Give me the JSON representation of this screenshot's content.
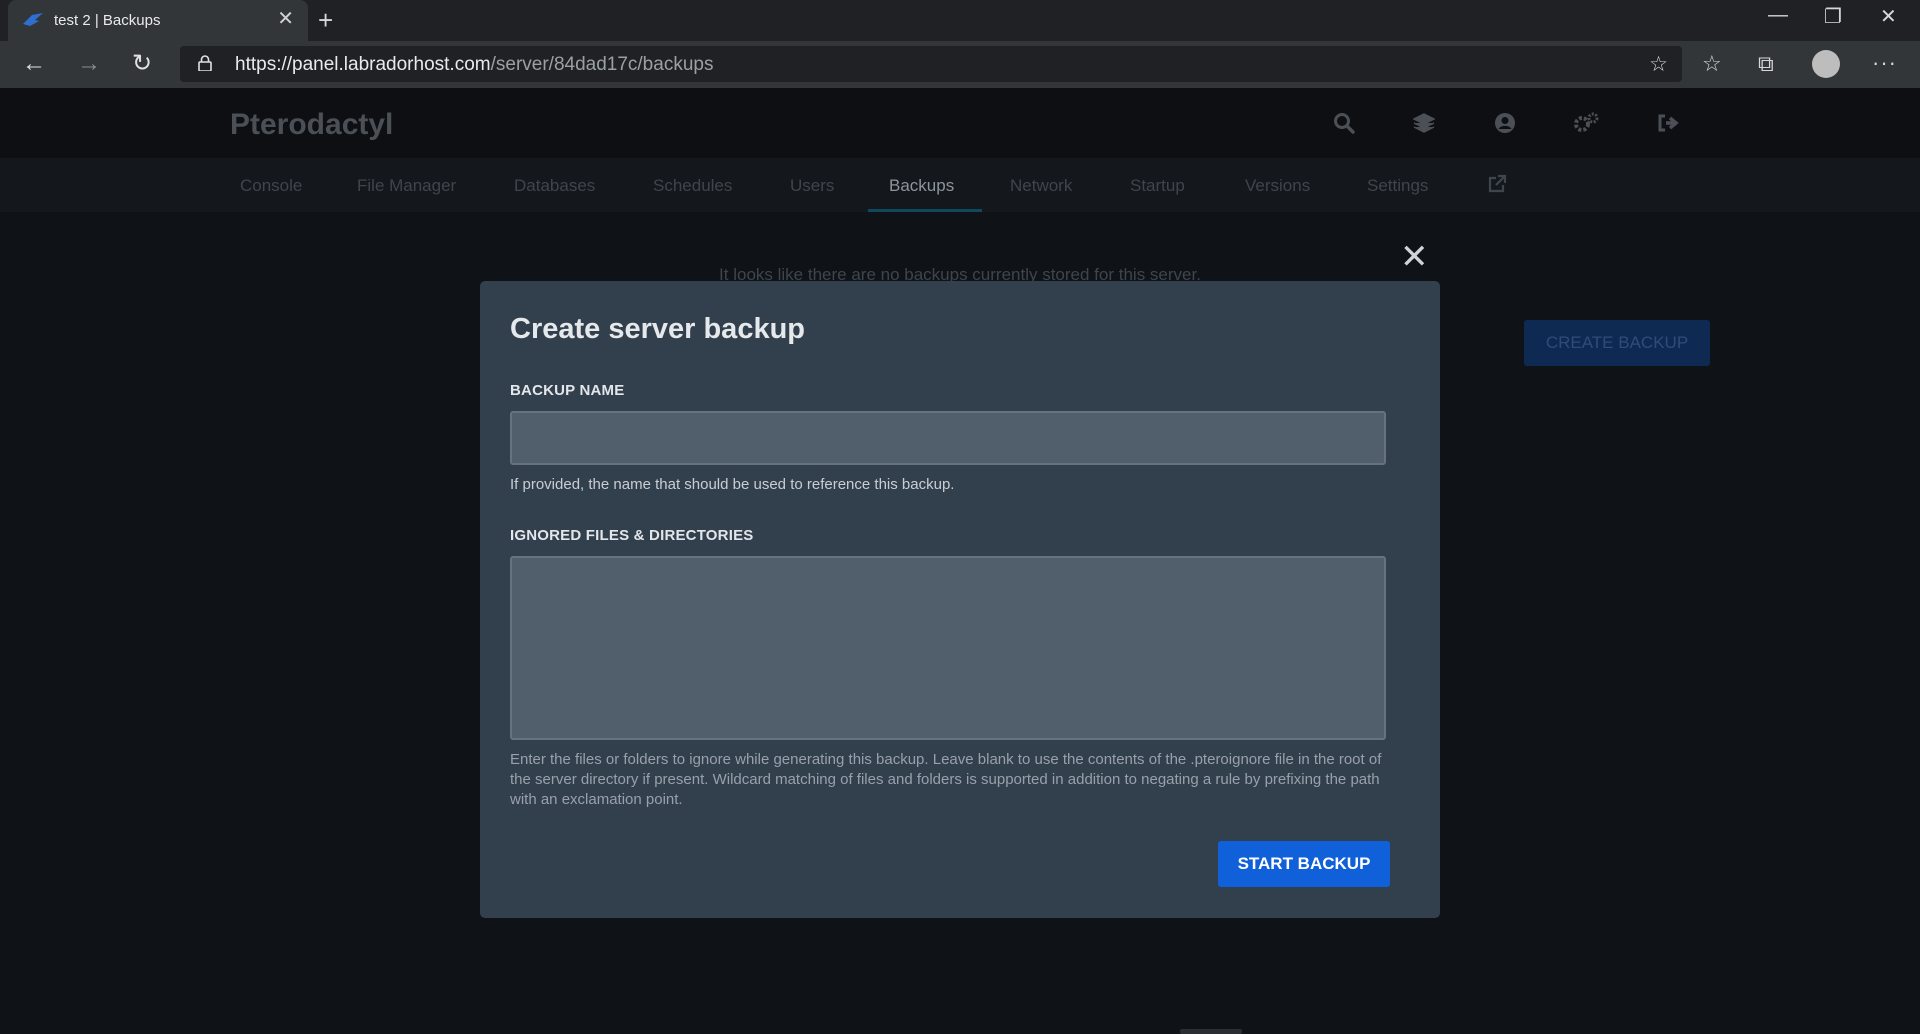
{
  "browser": {
    "tab_title": "test 2 | Backups",
    "url_host": "https://panel.labradorhost.com",
    "url_path": "/server/84dad17c/backups"
  },
  "panel": {
    "brand": "Pterodactyl",
    "nav_tabs": [
      {
        "label": "Console"
      },
      {
        "label": "File Manager"
      },
      {
        "label": "Databases"
      },
      {
        "label": "Schedules"
      },
      {
        "label": "Users"
      },
      {
        "label": "Backups",
        "active": true
      },
      {
        "label": "Network"
      },
      {
        "label": "Startup"
      },
      {
        "label": "Versions"
      },
      {
        "label": "Settings"
      }
    ],
    "empty_message": "It looks like there are no backups currently stored for this server.",
    "create_backup_label": "CREATE BACKUP"
  },
  "modal": {
    "title": "Create server backup",
    "name_label": "BACKUP NAME",
    "name_value": "",
    "name_help": "If provided, the name that should be used to reference this backup.",
    "ignored_label": "IGNORED FILES & DIRECTORIES",
    "ignored_value": "",
    "ignored_help": "Enter the files or folders to ignore while generating this backup. Leave blank to use the contents of the .pteroignore file in the root of the server directory if present. Wildcard matching of files and folders is supported in addition to negating a rule by prefixing the path with an exclamation point.",
    "start_label": "START BACKUP"
  },
  "colors": {
    "accent": "#1060d9",
    "modal_bg": "#323f4d"
  }
}
